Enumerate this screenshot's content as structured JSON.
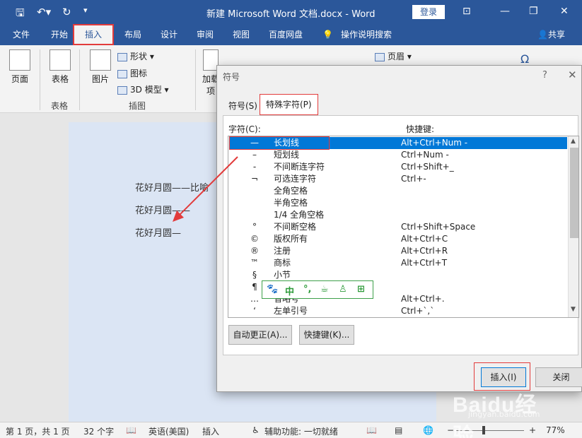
{
  "window": {
    "title": "新建 Microsoft Word 文档.docx  -  Word",
    "login": "登录"
  },
  "menu": {
    "tabs": [
      "文件",
      "开始",
      "插入",
      "布局",
      "设计",
      "审阅",
      "视图",
      "百度网盘"
    ],
    "tell_me": "操作说明搜索",
    "share": "共享"
  },
  "ribbon": {
    "pages": "页面",
    "table": "表格",
    "table_group": "表格",
    "pictures": "图片",
    "shapes": "形状",
    "icons": "图标",
    "model3d": "3D 模型",
    "illustrations_group": "插图",
    "addins": "加载项",
    "header": "页眉",
    "omega": "Ω"
  },
  "document": {
    "lines": [
      "花好月圆——比喻",
      "花好月圆——",
      "花好月圆—"
    ]
  },
  "dialog": {
    "title": "符号",
    "help": "?",
    "close": "✕",
    "tab_symbols": "符号(S)",
    "tab_special": "特殊字符(P)",
    "col_char": "字符(C):",
    "col_shortcut": "快捷键:",
    "rows": [
      {
        "sym": "—",
        "name": "长划线",
        "key": "Alt+Ctrl+Num -"
      },
      {
        "sym": "–",
        "name": "短划线",
        "key": "Ctrl+Num -"
      },
      {
        "sym": "-",
        "name": "不间断连字符",
        "key": "Ctrl+Shift+_"
      },
      {
        "sym": "¬",
        "name": "可选连字符",
        "key": "Ctrl+-"
      },
      {
        "sym": "",
        "name": "全角空格",
        "key": ""
      },
      {
        "sym": "",
        "name": "半角空格",
        "key": ""
      },
      {
        "sym": "",
        "name": "1/4 全角空格",
        "key": ""
      },
      {
        "sym": "°",
        "name": "不间断空格",
        "key": "Ctrl+Shift+Space"
      },
      {
        "sym": "©",
        "name": "版权所有",
        "key": "Alt+Ctrl+C"
      },
      {
        "sym": "®",
        "name": "注册",
        "key": "Alt+Ctrl+R"
      },
      {
        "sym": "™",
        "name": "商标",
        "key": "Alt+Ctrl+T"
      },
      {
        "sym": "§",
        "name": "小节",
        "key": ""
      },
      {
        "sym": "¶",
        "name": "",
        "key": ""
      },
      {
        "sym": "…",
        "name": "省略号",
        "key": "Alt+Ctrl+."
      },
      {
        "sym": "‘",
        "name": "左单引号",
        "key": "Ctrl+`,`"
      }
    ],
    "btn_autocorrect": "自动更正(A)...",
    "btn_shortcut": "快捷键(K)...",
    "btn_insert": "插入(I)",
    "btn_close": "关闭"
  },
  "ime": {
    "lang": "中",
    "punct": "°,"
  },
  "status": {
    "page": "第 1 页，共 1 页",
    "words": "32 个字",
    "lang": "英语(美国)",
    "mode": "插入",
    "accessibility": "辅助功能: 一切就绪",
    "zoom": "77%",
    "zoom_minus": "−",
    "zoom_plus": "+"
  },
  "watermark": {
    "logo": "Baidu经验",
    "url": "jingyan.baidu.com"
  },
  "colors": {
    "word_blue": "#2b579a",
    "highlight_red": "#e23b3b",
    "selection_blue": "#0078d7"
  }
}
